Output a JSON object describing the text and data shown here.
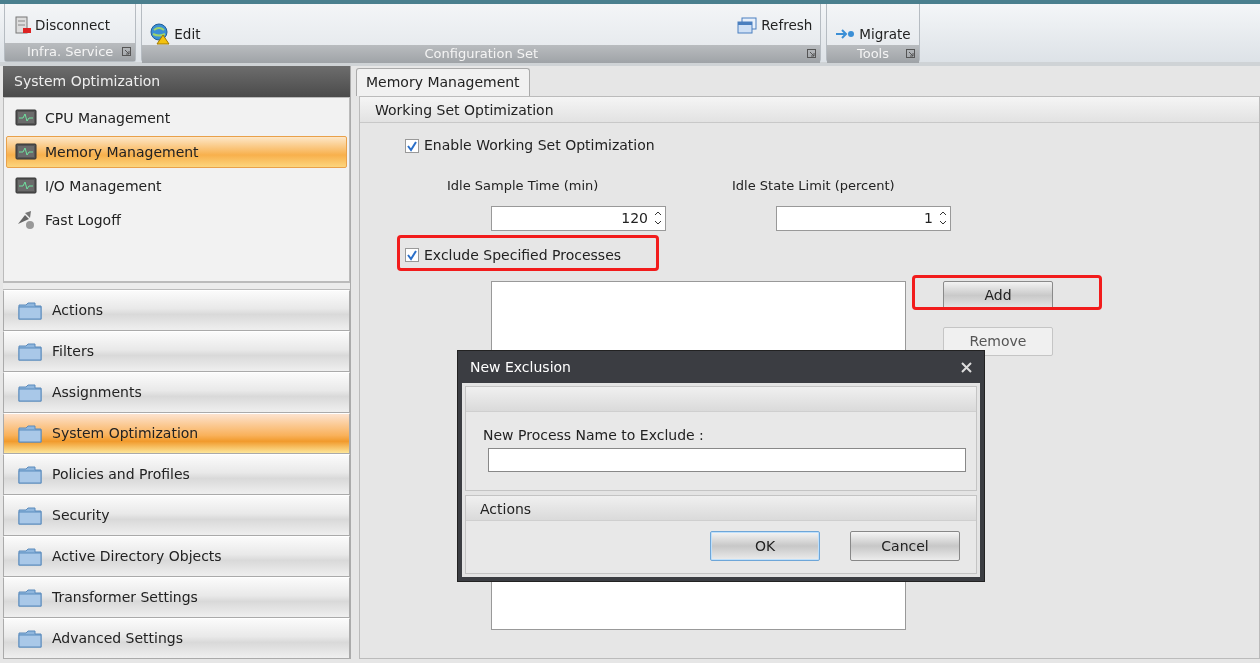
{
  "ribbon": {
    "groups": [
      {
        "label": "Infra. Service",
        "buttons": [
          {
            "label": "Disconnect",
            "kind": "disconnect"
          }
        ]
      },
      {
        "label": "Configuration Set",
        "buttons": [
          {
            "label": "Edit",
            "kind": "edit"
          },
          {
            "label": "Refresh",
            "kind": "refresh"
          }
        ]
      },
      {
        "label": "Tools",
        "buttons": [
          {
            "label": "Migrate",
            "kind": "migrate"
          }
        ]
      }
    ]
  },
  "sidebar": {
    "header": "System Optimization",
    "items": [
      {
        "label": "CPU Management",
        "kind": "monitor",
        "selected": false
      },
      {
        "label": "Memory Management",
        "kind": "monitor",
        "selected": true
      },
      {
        "label": "I/O Management",
        "kind": "monitor",
        "selected": false
      },
      {
        "label": "Fast Logoff",
        "kind": "logoff",
        "selected": false
      }
    ],
    "nav": [
      {
        "label": "Actions",
        "selected": false
      },
      {
        "label": "Filters",
        "selected": false
      },
      {
        "label": "Assignments",
        "selected": false
      },
      {
        "label": "System Optimization",
        "selected": true
      },
      {
        "label": "Policies and Profiles",
        "selected": false
      },
      {
        "label": "Security",
        "selected": false
      },
      {
        "label": "Active Directory Objects",
        "selected": false
      },
      {
        "label": "Transformer Settings",
        "selected": false
      },
      {
        "label": "Advanced Settings",
        "selected": false
      }
    ]
  },
  "tabs": [
    {
      "label": "Memory Management",
      "selected": true
    }
  ],
  "section": {
    "title": "Working Set Optimization"
  },
  "enable_checkbox": {
    "label": "Enable Working Set Optimization",
    "checked": true
  },
  "spinners": [
    {
      "label": "Idle Sample Time (min)",
      "value": "120"
    },
    {
      "label": "Idle State Limit (percent)",
      "value": "1"
    }
  ],
  "exclude_checkbox": {
    "label": "Exclude Specified Processes",
    "checked": true,
    "highlighted": true
  },
  "buttons": [
    {
      "label": "Add",
      "disabled": false,
      "highlighted": true
    },
    {
      "label": "Remove",
      "disabled": true,
      "highlighted": false
    }
  ],
  "dialog": {
    "title": "New Exclusion",
    "field_label": "New Process Name to Exclude :",
    "actions_header": "Actions",
    "buttons": [
      {
        "label": "OK",
        "default": true
      },
      {
        "label": "Cancel",
        "default": false
      }
    ]
  }
}
